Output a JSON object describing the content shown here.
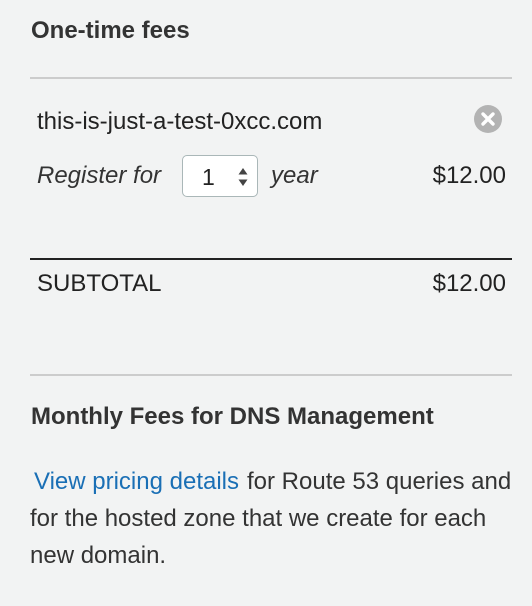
{
  "one_time_fees": {
    "title": "One-time fees",
    "domain": "this-is-just-a-test-0xcc.com",
    "register_label": "Register for",
    "years_value": "1",
    "year_label": "year",
    "price": "$12.00",
    "remove_icon": "close-circle-icon"
  },
  "subtotal": {
    "label": "SUBTOTAL",
    "amount": "$12.00"
  },
  "monthly_fees": {
    "title": "Monthly Fees for DNS Management",
    "link_text": "View pricing details",
    "description_line1": "for Route 53 queries and for the hosted zone that we create for each new domain."
  },
  "colors": {
    "background": "#f2f3f3",
    "link": "#1a6fb5",
    "divider": "#cccccc",
    "subtotal_divider": "#222222",
    "remove_icon": "#b3b3b3"
  }
}
